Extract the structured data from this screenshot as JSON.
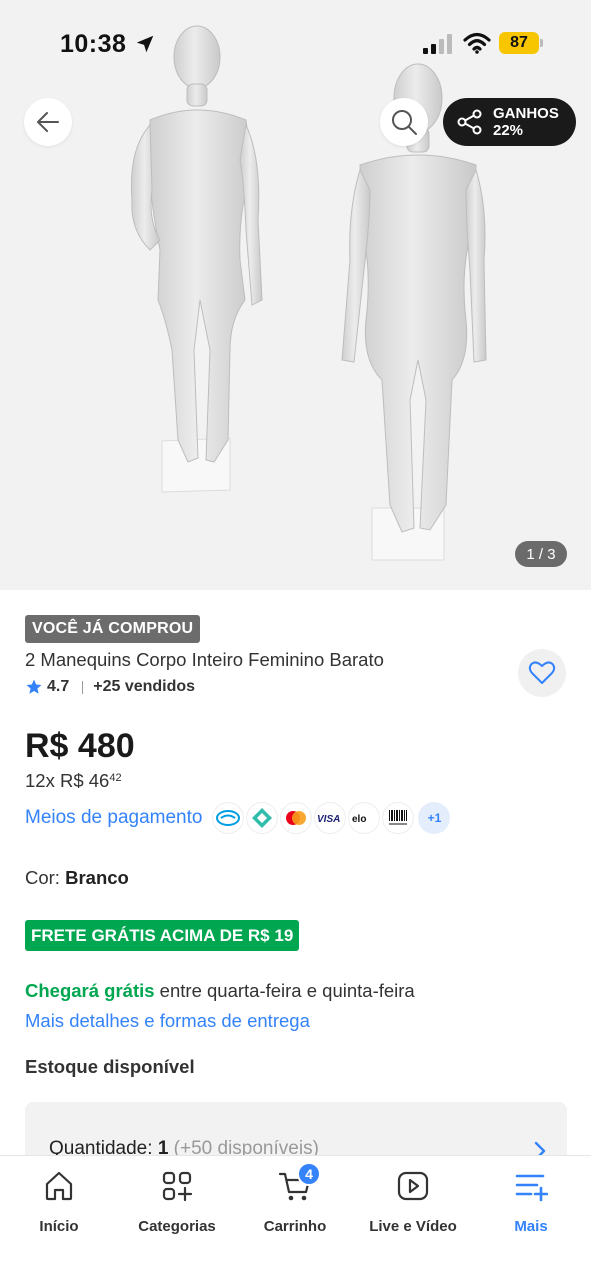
{
  "status_bar": {
    "time": "10:38",
    "battery": "87",
    "battery_color": "#f7c600"
  },
  "header": {
    "back_icon": "arrow-left-icon",
    "search_icon": "search-icon",
    "earnings": {
      "icon": "share-icon",
      "label": "GANHOS",
      "percent": "22%"
    }
  },
  "gallery": {
    "counter": "1 / 3",
    "image_alt_subject": "mannequins"
  },
  "product": {
    "badge": "VOCÊ JÁ COMPROU",
    "title": "2 Manequins Corpo Inteiro Feminino Barato",
    "rating": "4.7",
    "sold": "+25 vendidos",
    "price": "R$ 480",
    "installments_prefix": "12x R$ 46",
    "installments_cents": "42",
    "payment_link": "Meios de pagamento",
    "payment_more": "+1",
    "payment_methods": [
      "mercado-pago-icon",
      "pix-icon",
      "mastercard-icon",
      "visa-icon",
      "elo-icon",
      "boleto-icon"
    ],
    "color_label": "Cor:",
    "color_value": "Branco",
    "free_shipping": "FRETE GRÁTIS ACIMA DE R$ 19",
    "delivery_green": "Chegará grátis",
    "delivery_rest": " entre quarta-feira e quinta-feira",
    "delivery_link": "Mais detalhes e formas de entrega",
    "stock": "Estoque disponível",
    "quantity_label": "Quantidade:",
    "quantity_value": "1",
    "quantity_available": "(+50 disponíveis)"
  },
  "bottom_nav": {
    "items": [
      {
        "label": "Início",
        "icon": "home-icon"
      },
      {
        "label": "Categorias",
        "icon": "categories-icon"
      },
      {
        "label": "Carrinho",
        "icon": "cart-icon",
        "badge": "4"
      },
      {
        "label": "Live e Vídeo",
        "icon": "play-icon"
      },
      {
        "label": "Mais",
        "icon": "menu-icon",
        "active": true
      }
    ]
  },
  "colors": {
    "accent_blue": "#3483fa",
    "success_green": "#00a650",
    "badge_gray": "#6c6c6c"
  }
}
